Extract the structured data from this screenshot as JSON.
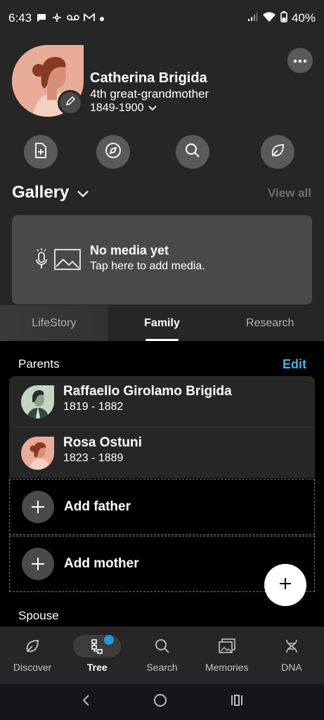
{
  "status": {
    "time": "6:43",
    "battery": "40%"
  },
  "profile": {
    "name": "Catherina Brigida",
    "relation": "4th great-grandmother",
    "dates": "1849-1900"
  },
  "gallery": {
    "title": "Gallery",
    "view_all": "View all",
    "empty_title": "No media yet",
    "empty_sub": "Tap here to add media."
  },
  "tabs": [
    {
      "label": "LifeStory"
    },
    {
      "label": "Family"
    },
    {
      "label": "Research"
    }
  ],
  "parents": {
    "title": "Parents",
    "edit": "Edit",
    "items": [
      {
        "name": "Raffaello Girolamo Brigida",
        "dates": "1819 - 1882"
      },
      {
        "name": "Rosa Ostuni",
        "dates": "1823 - 1889"
      }
    ],
    "add_father": "Add father",
    "add_mother": "Add mother"
  },
  "spouse": {
    "title": "Spouse"
  },
  "nav": [
    {
      "label": "Discover"
    },
    {
      "label": "Tree"
    },
    {
      "label": "Search"
    },
    {
      "label": "Memories"
    },
    {
      "label": "DNA"
    }
  ],
  "colors": {
    "accent": "#4ab2e6",
    "background": "#262626",
    "badge": "#1e9bd7"
  }
}
